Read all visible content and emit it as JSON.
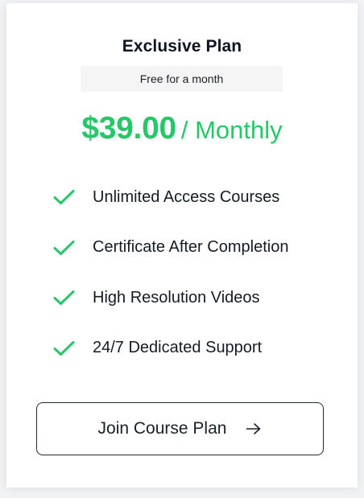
{
  "plan": {
    "title": "Exclusive Plan",
    "promo": "Free for a month",
    "price": "$39.00",
    "period": "/ Monthly"
  },
  "features": [
    {
      "label": "Unlimited Access Courses",
      "icon": "check-icon"
    },
    {
      "label": "Certificate After Completion",
      "icon": "check-icon"
    },
    {
      "label": "High Resolution Videos",
      "icon": "check-icon"
    },
    {
      "label": "24/7 Dedicated Support",
      "icon": "check-icon"
    }
  ],
  "cta": {
    "label": "Join Course Plan",
    "icon": "arrow-right-icon"
  },
  "colors": {
    "accent": "#26c768",
    "text": "#12181f",
    "promo_bg": "#f5f5f6",
    "border": "#1f2a33"
  }
}
